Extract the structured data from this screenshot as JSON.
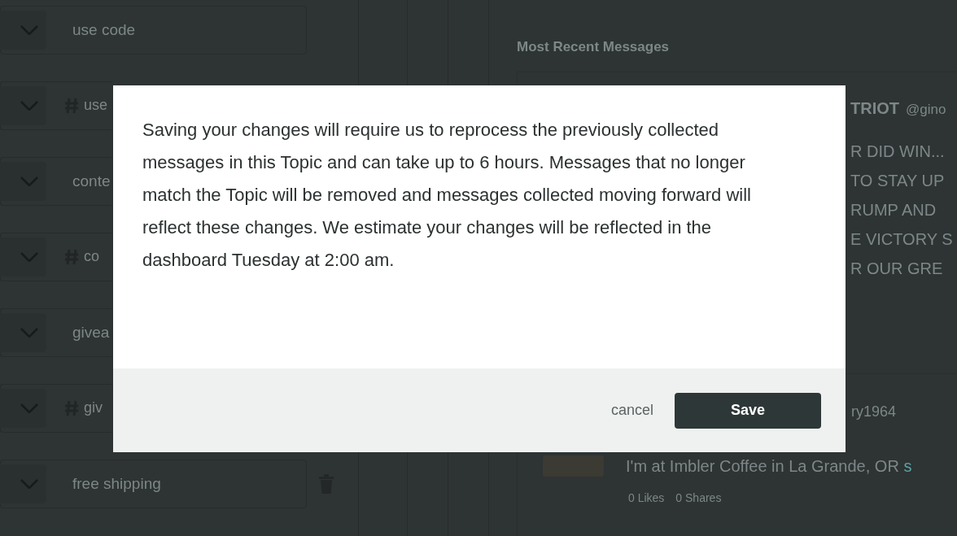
{
  "rules": [
    {
      "kind": "keyword",
      "value": "use code",
      "removable": false
    },
    {
      "kind": "hashtag",
      "value": "use"
    },
    {
      "kind": "keyword",
      "value": "conte"
    },
    {
      "kind": "hashtag",
      "value": "co"
    },
    {
      "kind": "keyword",
      "value": "givea"
    },
    {
      "kind": "hashtag",
      "value": "giv"
    },
    {
      "kind": "keyword",
      "value": "free shipping",
      "removable": true
    }
  ],
  "messages_panel": {
    "title": "Most Recent Messages",
    "messages": [
      {
        "author": "TRIOT",
        "handle": "@gino",
        "lines": [
          "R DID WIN...",
          "TO STAY UP",
          "RUMP AND",
          "E VICTORY S",
          "R OUR GRE"
        ]
      },
      {
        "handle": "ry1964",
        "text": "I'm at Imbler Coffee in La Grande, OR",
        "link": "s",
        "likes": "0 Likes",
        "shares": "0 Shares"
      }
    ]
  },
  "dialog": {
    "message": "Saving your changes will require us to reprocess the previously collected messages in this Topic and can take up to 6 hours. Messages that no longer match the Topic will be removed and messages collected moving forward will reflect these changes. We estimate your changes will be reflected in the dashboard Tuesday at 2:00 am.",
    "buttons": [
      {
        "kind": "link",
        "label": "cancel"
      },
      {
        "kind": "primary",
        "label": "Save"
      }
    ]
  }
}
